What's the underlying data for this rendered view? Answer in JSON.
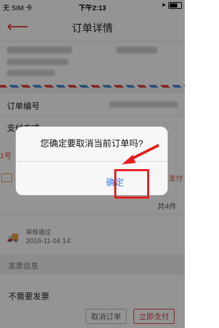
{
  "status": {
    "carrier": "无 SIM 卡",
    "time": "下午2:13"
  },
  "nav": {
    "title": "订单详情"
  },
  "order": {
    "number_label": "订单编号",
    "payment_label": "支付方式",
    "items_count": "共4件",
    "review_status": "审核通过",
    "review_time": "2016-11-04 14:",
    "invoice_section": "发票信息",
    "invoice_value": "不需要发票",
    "side_partial": "1号",
    "side_pay_partial": "支付"
  },
  "actions": {
    "cancel": "取消订单",
    "pay": "立即支付"
  },
  "dialog": {
    "message": "您确定要取消当前订单吗?",
    "confirm": "确定"
  },
  "colors": {
    "accent": "#e0453f",
    "link": "#2f7ce0",
    "highlight": "#e61c1c"
  }
}
